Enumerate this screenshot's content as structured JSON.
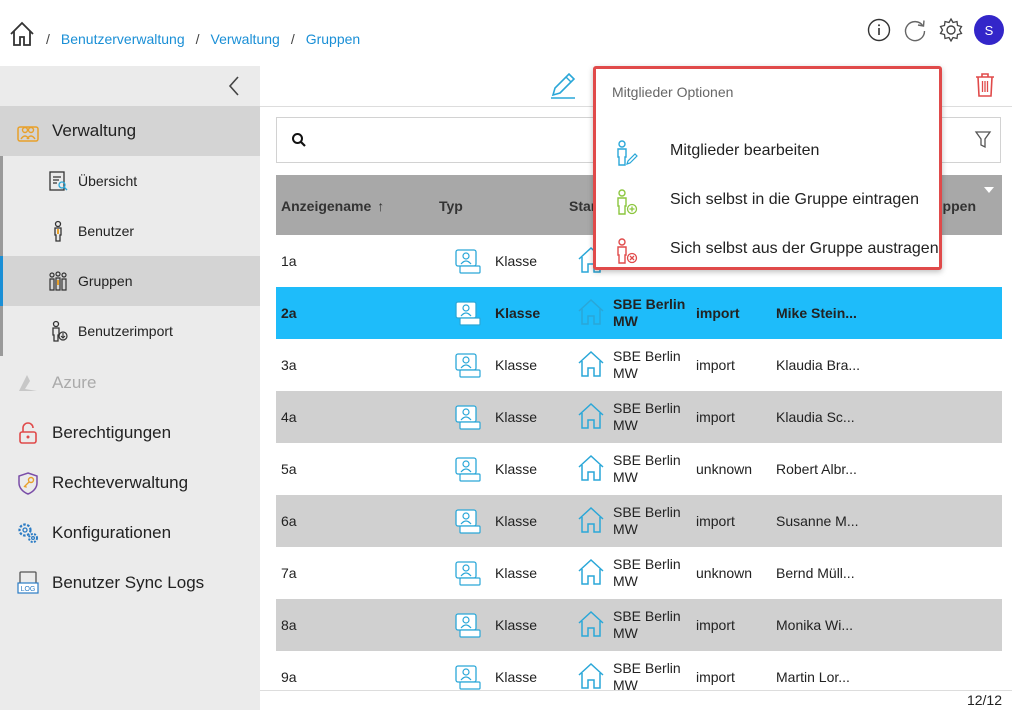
{
  "breadcrumb": {
    "separator": "/",
    "items": [
      "Benutzerverwaltung",
      "Verwaltung",
      "Gruppen"
    ]
  },
  "header": {
    "avatar_initial": "S",
    "avatar_color": "#3326c9"
  },
  "sidebar": {
    "items": [
      {
        "label": "Verwaltung",
        "icon": "users-folder-icon",
        "selected": true
      },
      {
        "label": "Azure",
        "icon": "azure-icon",
        "disabled": true
      },
      {
        "label": "Berechtigungen",
        "icon": "lock-icon"
      },
      {
        "label": "Rechteverwaltung",
        "icon": "shield-key-icon"
      },
      {
        "label": "Konfigurationen",
        "icon": "gears-icon"
      },
      {
        "label": "Benutzer Sync Logs",
        "icon": "log-icon"
      }
    ],
    "sub_items": [
      {
        "label": "Übersicht",
        "icon": "overview-icon"
      },
      {
        "label": "Benutzer",
        "icon": "user-icon"
      },
      {
        "label": "Gruppen",
        "icon": "group-icon",
        "selected": true
      },
      {
        "label": "Benutzerimport",
        "icon": "user-import-icon"
      }
    ]
  },
  "table": {
    "columns": [
      "Anzeigename",
      "Typ",
      "Star",
      "uppen"
    ],
    "sort_indicator": "↑",
    "rows": [
      {
        "name": "1a",
        "typ": "Klasse",
        "standort": [
          "",
          ""
        ],
        "source": "",
        "owner": "",
        "style": "white"
      },
      {
        "name": "2a",
        "typ": "Klasse",
        "standort": [
          "SBE Berlin",
          "MW"
        ],
        "source": "import",
        "owner": "Mike Stein...",
        "style": "sel"
      },
      {
        "name": "3a",
        "typ": "Klasse",
        "standort": [
          "SBE Berlin",
          "MW"
        ],
        "source": "import",
        "owner": "Klaudia Bra...",
        "style": "white"
      },
      {
        "name": "4a",
        "typ": "Klasse",
        "standort": [
          "SBE Berlin",
          "MW"
        ],
        "source": "import",
        "owner": "Klaudia Sc...",
        "style": "alt"
      },
      {
        "name": "5a",
        "typ": "Klasse",
        "standort": [
          "SBE Berlin",
          "MW"
        ],
        "source": "unknown",
        "owner": "Robert Albr...",
        "style": "white"
      },
      {
        "name": "6a",
        "typ": "Klasse",
        "standort": [
          "SBE Berlin",
          "MW"
        ],
        "source": "import",
        "owner": "Susanne M...",
        "style": "alt"
      },
      {
        "name": "7a",
        "typ": "Klasse",
        "standort": [
          "SBE Berlin",
          "MW"
        ],
        "source": "unknown",
        "owner": "Bernd Müll...",
        "style": "white"
      },
      {
        "name": "8a",
        "typ": "Klasse",
        "standort": [
          "SBE Berlin",
          "MW"
        ],
        "source": "import",
        "owner": "Monika Wi...",
        "style": "alt"
      },
      {
        "name": "9a",
        "typ": "Klasse",
        "standort": [
          "SBE Berlin",
          "MW"
        ],
        "source": "import",
        "owner": "Martin Lor...",
        "style": "white"
      }
    ]
  },
  "pager": "12/12",
  "popup": {
    "title": "Mitglieder Optionen",
    "options": [
      {
        "label": "Mitglieder bearbeiten",
        "icon": "edit-members-icon",
        "color": "#2aa7d8"
      },
      {
        "label": "Sich selbst in die Gruppe eintragen",
        "icon": "add-self-icon",
        "color": "#8cc63f"
      },
      {
        "label": "Sich selbst aus der Gruppe austragen",
        "icon": "remove-self-icon",
        "color": "#e04a4a"
      }
    ]
  },
  "colors": {
    "accent": "#1a8fd6",
    "selected_row": "#1ebcfa",
    "header_bg": "#a8a8a8",
    "popup_border": "#e04a4a",
    "delete": "#e04a4a"
  }
}
